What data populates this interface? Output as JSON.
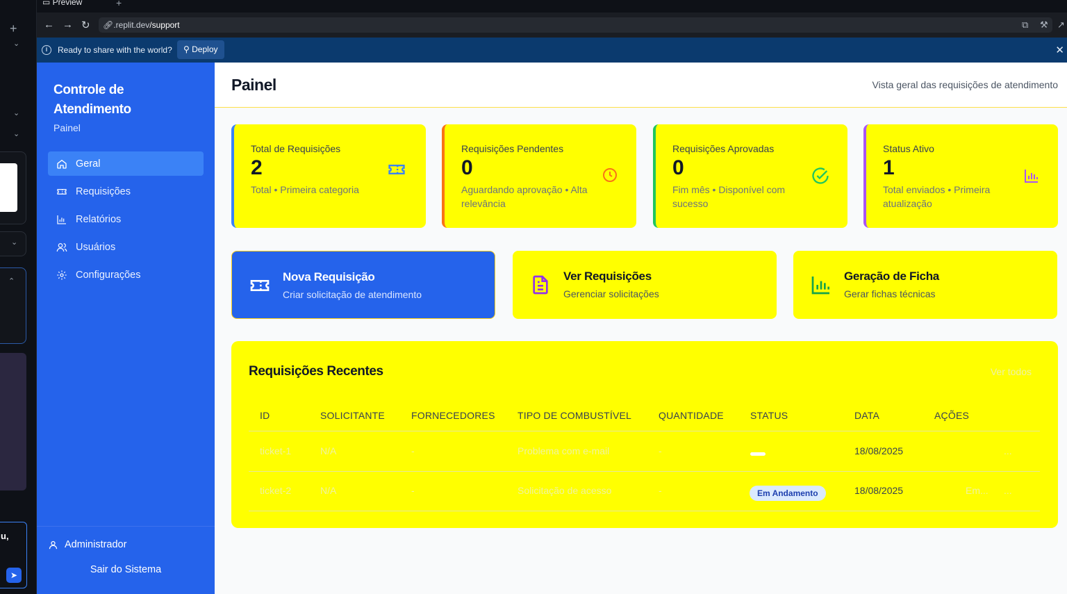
{
  "browser": {
    "tab_label": "Preview",
    "url_host": ".replit.dev",
    "url_path": "/support",
    "deploy_message": "Ready to share with the world?",
    "deploy_button": "Deploy"
  },
  "sidebar": {
    "brand": "Controle de Atendimento",
    "subtitle": "Painel",
    "items": [
      {
        "label": "Geral",
        "icon": "home-icon",
        "active": true
      },
      {
        "label": "Requisições",
        "icon": "ticket-icon",
        "active": false
      },
      {
        "label": "Relatórios",
        "icon": "bar-chart-icon",
        "active": false
      },
      {
        "label": "Usuários",
        "icon": "users-icon",
        "active": false
      },
      {
        "label": "Configurações",
        "icon": "gear-icon",
        "active": false
      }
    ],
    "user": "Administrador",
    "logout": "Sair do Sistema"
  },
  "header": {
    "title": "Painel",
    "description": "Vista geral das requisições de atendimento"
  },
  "stats": [
    {
      "label": "Total de Requisições",
      "value": "2",
      "sub": "Total • Primeira categoria",
      "icon": "ticket-icon",
      "accent": "#3b82f6"
    },
    {
      "label": "Requisições Pendentes",
      "value": "0",
      "sub": "Aguardando aprovação • Alta relevância",
      "icon": "clock-icon",
      "accent": "#f97316"
    },
    {
      "label": "Requisições Aprovadas",
      "value": "0",
      "sub": "Fim mês • Disponível com sucesso",
      "icon": "check-circle-icon",
      "accent": "#22c55e"
    },
    {
      "label": "Status Ativo",
      "value": "1",
      "sub": "Total enviados • Primeira atualização",
      "icon": "bar-chart-icon",
      "accent": "#a855f7"
    }
  ],
  "actions": [
    {
      "title": "Nova Requisição",
      "subtitle": "Criar solicitação de atendimento",
      "icon": "ticket-icon"
    },
    {
      "title": "Ver Requisições",
      "subtitle": "Gerenciar solicitações",
      "icon": "document-icon"
    },
    {
      "title": "Geração de Ficha",
      "subtitle": "Gerar fichas técnicas",
      "icon": "bar-chart-icon"
    }
  ],
  "recent": {
    "title": "Requisições Recentes",
    "see_all": "Ver todos",
    "columns": [
      "ID",
      "SOLICITANTE",
      "FORNECEDORES",
      "TIPO DE COMBUSTÍVEL",
      "QUANTIDADE",
      "STATUS",
      "DATA",
      "AÇÕES"
    ],
    "rows": [
      {
        "id": "ticket-1",
        "requester": "N/A",
        "supplier": "-",
        "type": "Problema com e-mail",
        "quantity": "-",
        "status": "",
        "date": "18/08/2025",
        "action_edit": "",
        "action_more": "..."
      },
      {
        "id": "ticket-2",
        "requester": "N/A",
        "supplier": "-",
        "type": "Solicitação de acesso",
        "quantity": "-",
        "status": "Em Andamento",
        "date": "18/08/2025",
        "action_edit": "Em...",
        "action_more": "..."
      }
    ]
  },
  "colors": {
    "sidebar": "#2563eb",
    "card": "#ffff00",
    "deploy_bar": "#0b3a6e"
  }
}
